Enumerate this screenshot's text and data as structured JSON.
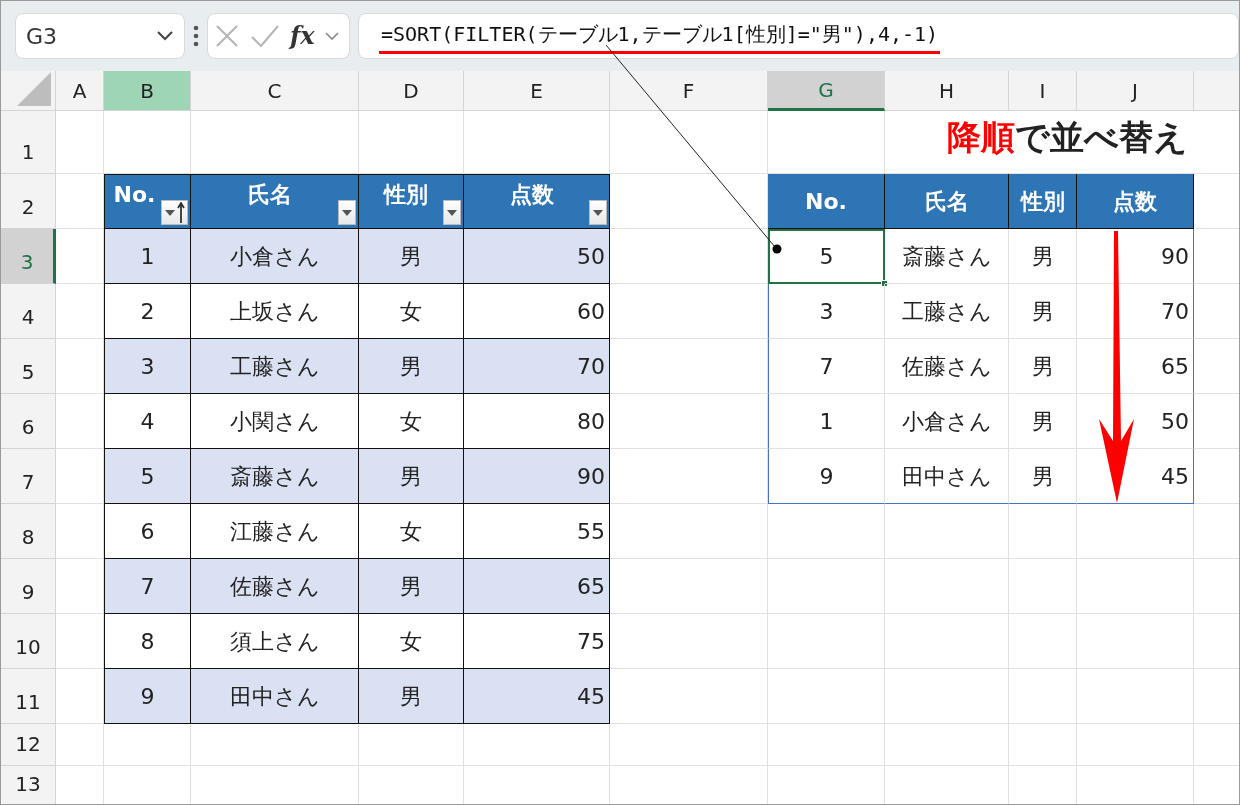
{
  "name_box": {
    "value": "G3"
  },
  "formula_bar": {
    "function_button": "fx",
    "formula": "=SORT(FILTER(テーブル1,テーブル1[性別]=\"男\"),4,-1)",
    "underlined": true
  },
  "column_headers": [
    {
      "label": "A",
      "selected": false,
      "highlighted": false
    },
    {
      "label": "B",
      "selected": false,
      "highlighted": true
    },
    {
      "label": "C",
      "selected": false,
      "highlighted": false
    },
    {
      "label": "D",
      "selected": false,
      "highlighted": false
    },
    {
      "label": "E",
      "selected": false,
      "highlighted": false
    },
    {
      "label": "F",
      "selected": false,
      "highlighted": false
    },
    {
      "label": "G",
      "selected": true,
      "highlighted": false
    },
    {
      "label": "H",
      "selected": false,
      "highlighted": false
    },
    {
      "label": "I",
      "selected": false,
      "highlighted": false
    },
    {
      "label": "J",
      "selected": false,
      "highlighted": false
    }
  ],
  "row_headers": [
    {
      "label": "1",
      "selected": false
    },
    {
      "label": "2",
      "selected": false
    },
    {
      "label": "3",
      "selected": true
    },
    {
      "label": "4",
      "selected": false
    },
    {
      "label": "5",
      "selected": false
    },
    {
      "label": "6",
      "selected": false
    },
    {
      "label": "7",
      "selected": false
    },
    {
      "label": "8",
      "selected": false
    },
    {
      "label": "9",
      "selected": false
    },
    {
      "label": "10",
      "selected": false
    },
    {
      "label": "11",
      "selected": false
    },
    {
      "label": "12",
      "selected": false
    },
    {
      "label": "13",
      "selected": false
    }
  ],
  "source_table": {
    "columns": [
      {
        "label": "No.",
        "sorted": true
      },
      {
        "label": "氏名",
        "sorted": false
      },
      {
        "label": "性別",
        "sorted": false
      },
      {
        "label": "点数",
        "sorted": false
      }
    ],
    "rows": [
      [
        "1",
        "小倉さん",
        "男",
        "50"
      ],
      [
        "2",
        "上坂さん",
        "女",
        "60"
      ],
      [
        "3",
        "工藤さん",
        "男",
        "70"
      ],
      [
        "4",
        "小関さん",
        "女",
        "80"
      ],
      [
        "5",
        "斎藤さん",
        "男",
        "90"
      ],
      [
        "6",
        "江藤さん",
        "女",
        "55"
      ],
      [
        "7",
        "佐藤さん",
        "男",
        "65"
      ],
      [
        "8",
        "須上さん",
        "女",
        "75"
      ],
      [
        "9",
        "田中さん",
        "男",
        "45"
      ]
    ]
  },
  "result_table": {
    "columns": [
      "No.",
      "氏名",
      "性別",
      "点数"
    ],
    "rows": [
      {
        "cells": [
          "5",
          "斎藤さん",
          "男",
          "90"
        ],
        "selected": true
      },
      {
        "cells": [
          "3",
          "工藤さん",
          "男",
          "70"
        ],
        "selected": false
      },
      {
        "cells": [
          "7",
          "佐藤さん",
          "男",
          "65"
        ],
        "selected": false
      },
      {
        "cells": [
          "1",
          "小倉さん",
          "男",
          "50"
        ],
        "selected": false
      },
      {
        "cells": [
          "9",
          "田中さん",
          "男",
          "45"
        ],
        "selected": false
      }
    ]
  },
  "annotation": {
    "title_parts": [
      {
        "text": "降順",
        "emphasis": true
      },
      {
        "text": "で並べ替え",
        "emphasis": false
      }
    ]
  }
}
